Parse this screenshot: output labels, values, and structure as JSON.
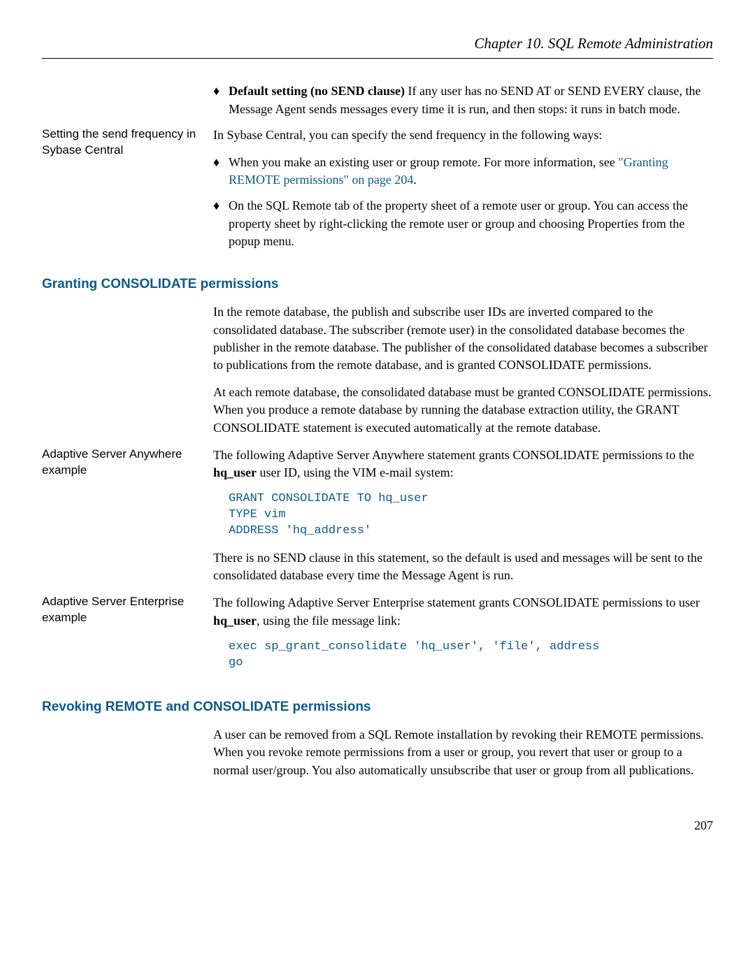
{
  "chapter": "Chapter 10.   SQL Remote Administration",
  "bullets_top": [
    {
      "lead": "Default setting (no SEND clause)",
      "text": "   If any user has no SEND AT or SEND EVERY clause, the Message Agent sends messages every time it is run, and then stops: it runs in batch mode."
    }
  ],
  "send_sidebar": "Setting the send frequency in Sybase Central",
  "send_intro": "In Sybase Central, you can specify the send frequency in the following ways:",
  "send_bullets": [
    {
      "pre": "When you make an existing user or group remote. For more information, see ",
      "link": "\"Granting REMOTE permissions\" on page 204",
      "post": "."
    },
    {
      "text": "On the SQL Remote tab of the property sheet of a remote user or group. You can access the property sheet by right-clicking the remote user or group and choosing Properties from the popup menu."
    }
  ],
  "sec1_heading": "Granting CONSOLIDATE permissions",
  "sec1_p1": "In the remote database, the publish and subscribe user IDs are inverted compared to the consolidated database. The subscriber (remote user) in the consolidated database becomes the publisher in the remote database. The publisher of the consolidated database becomes a subscriber to publications from the remote database, and is granted CONSOLIDATE permissions.",
  "sec1_p2": "At each remote database, the consolidated database must be granted CONSOLIDATE permissions. When you produce a remote database by running the database extraction utility, the GRANT CONSOLIDATE statement is executed automatically at the remote database.",
  "asa_sidebar": "Adaptive Server Anywhere example",
  "asa_text_pre": "The following Adaptive Server Anywhere statement grants CONSOLIDATE permissions to the ",
  "asa_text_bold": "hq_user",
  "asa_text_post": " user ID, using the VIM e-mail system:",
  "asa_code": "GRANT CONSOLIDATE TO hq_user\nTYPE vim\nADDRESS 'hq_address'",
  "asa_p2": "There is no SEND clause in this statement, so the default is used and messages will be sent to the consolidated database every time the Message Agent is run.",
  "ase_sidebar": "Adaptive Server Enterprise example",
  "ase_text_pre": "The following Adaptive Server Enterprise statement grants CONSOLIDATE permissions to user ",
  "ase_text_bold": "hq_user",
  "ase_text_post": ", using the file message link:",
  "ase_code": "exec sp_grant_consolidate 'hq_user', 'file', address\ngo",
  "sec2_heading": "Revoking REMOTE and CONSOLIDATE permissions",
  "sec2_p": "A user can be removed from a SQL Remote installation by revoking their REMOTE permissions. When you revoke remote permissions from a user or group, you revert that user or group to a normal user/group. You also automatically unsubscribe that user or group from all publications.",
  "page_number": "207"
}
